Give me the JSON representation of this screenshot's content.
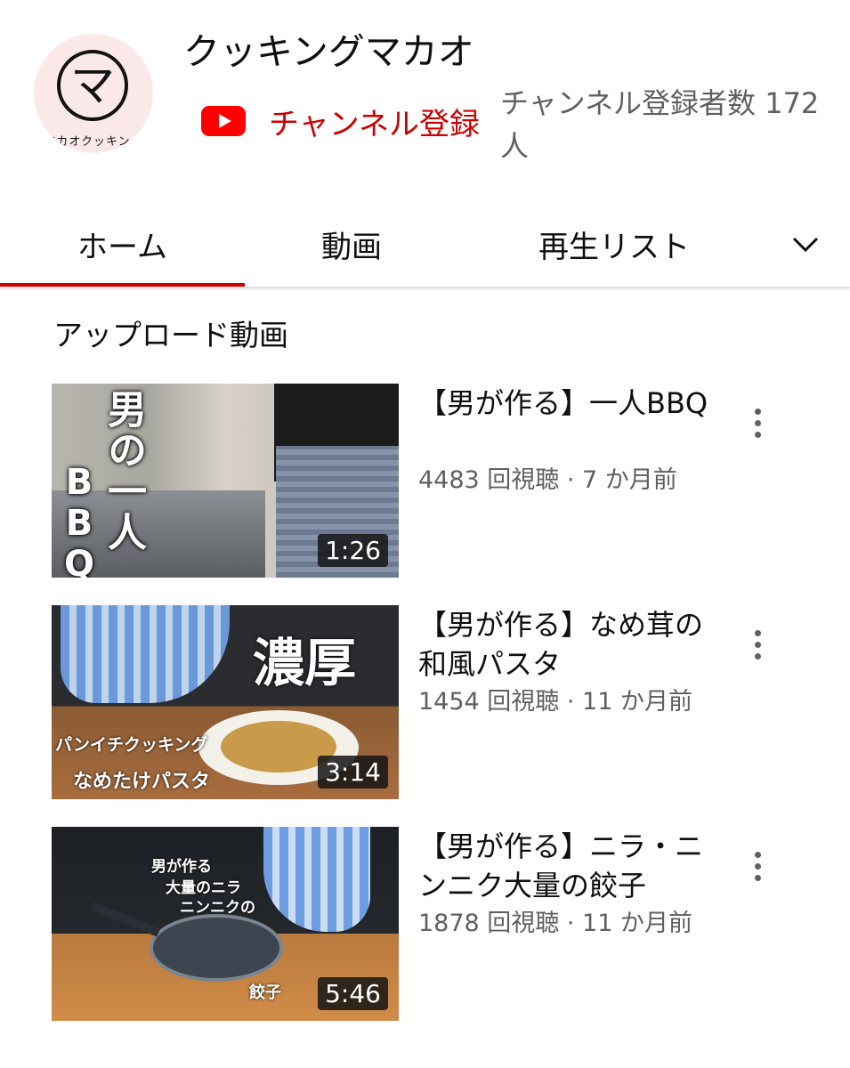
{
  "channel": {
    "name": "クッキングマカオ",
    "avatar_char": "マ",
    "avatar_text": "マカオクッキング",
    "subscribe_label": "チャンネル登録",
    "subscriber_count": "チャンネル登録者数 172人"
  },
  "tabs": [
    {
      "label": "ホーム",
      "active": true
    },
    {
      "label": "動画",
      "active": false
    },
    {
      "label": "再生リスト",
      "active": false
    }
  ],
  "section_title": "アップロード動画",
  "videos": [
    {
      "title": "【男が作る】一人BBQ",
      "meta": "4483 回視聴 · 7 か月前",
      "duration": "1:26",
      "thumb_text": {
        "line1": "男の一人",
        "line2": "BBQ"
      }
    },
    {
      "title": "【男が作る】なめ茸の和風パスタ",
      "meta": "1454 回視聴 · 11 か月前",
      "duration": "3:14",
      "thumb_text": {
        "big": "濃厚",
        "line1": "パンイチクッキング",
        "line2": "なめたけパスタ"
      }
    },
    {
      "title": "【男が作る】ニラ・ニンニク大量の餃子",
      "meta": "1878 回視聴 · 11 か月前",
      "duration": "5:46",
      "thumb_text": {
        "line1": "男が作る",
        "line2": "大量のニラ",
        "line3": "ニンニクの",
        "line4": "餃子"
      }
    }
  ],
  "colors": {
    "accent": "#cc0000",
    "secondary_text": "#606060"
  },
  "icons": [
    "youtube-logo-icon",
    "chevron-down-icon",
    "more-vert-icon"
  ]
}
